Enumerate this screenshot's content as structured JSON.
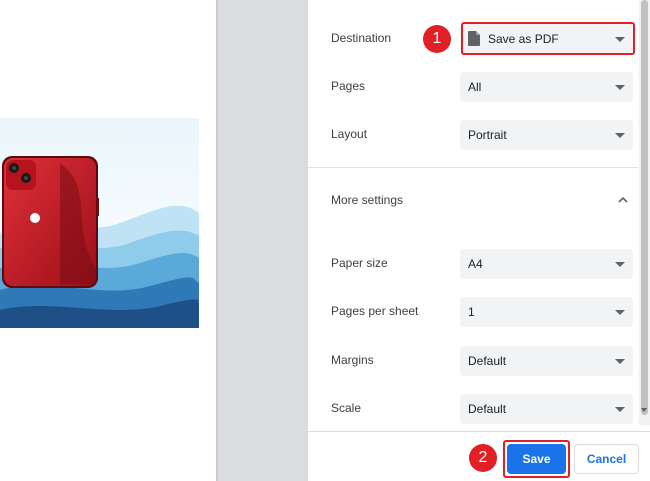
{
  "settings": {
    "destination": {
      "label": "Destination",
      "value": "Save as PDF"
    },
    "pages": {
      "label": "Pages",
      "value": "All"
    },
    "layout": {
      "label": "Layout",
      "value": "Portrait"
    },
    "more_settings_label": "More settings",
    "paper_size": {
      "label": "Paper size",
      "value": "A4"
    },
    "pages_per_sheet": {
      "label": "Pages per sheet",
      "value": "1"
    },
    "margins": {
      "label": "Margins",
      "value": "Default"
    },
    "scale": {
      "label": "Scale",
      "value": "Default"
    }
  },
  "actions": {
    "save_label": "Save",
    "cancel_label": "Cancel"
  },
  "annotations": {
    "step1": "1",
    "step2": "2"
  },
  "colors": {
    "accent": "#1a73e8",
    "highlight": "#e01f26",
    "select_bg": "#f1f3f4"
  },
  "icons": {
    "destination": "file-icon",
    "expand": "chevron-up-icon",
    "dropdown": "caret-down-icon"
  }
}
